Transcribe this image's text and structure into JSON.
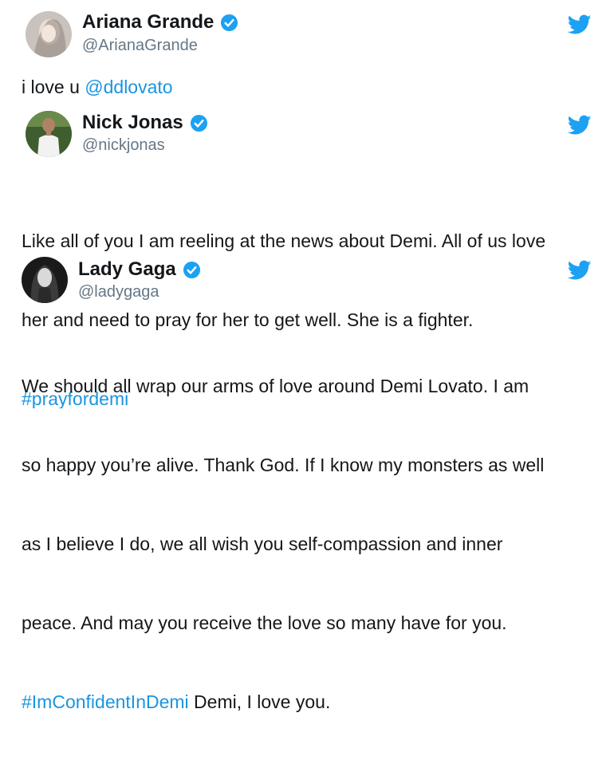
{
  "tweets": [
    {
      "name": "Ariana Grande",
      "handle": "@ArianaGrande",
      "text_before": "i love u ",
      "mention": "@ddlovato",
      "text_after": ""
    },
    {
      "name": "Nick Jonas",
      "handle": "@nickjonas",
      "text_line1": "Like all of you I am reeling at the news about Demi. All of us love",
      "text_line2": "her and need to pray for her to get well. She is a fighter.",
      "hashtag": "#prayfordemi"
    },
    {
      "name": "Lady Gaga",
      "handle": "@ladygaga",
      "text_line1": "We should all wrap our arms of love around Demi Lovato. I am",
      "text_line2": "so happy you’re alive. Thank God. If I know my monsters as well",
      "text_line3": "as I believe I do, we all wish you self-compassion and inner",
      "text_line4": "peace. And may you receive the love so many have for you.",
      "hashtag": "#ImConfidentInDemi",
      "text_after": " Demi, I love you."
    }
  ],
  "colors": {
    "link": "#1b95e0",
    "verified": "#1da1f2",
    "bird": "#1da1f2",
    "handle": "#657786"
  },
  "icons": {
    "verified": "verified-badge-icon",
    "brand": "twitter-bird-icon"
  }
}
